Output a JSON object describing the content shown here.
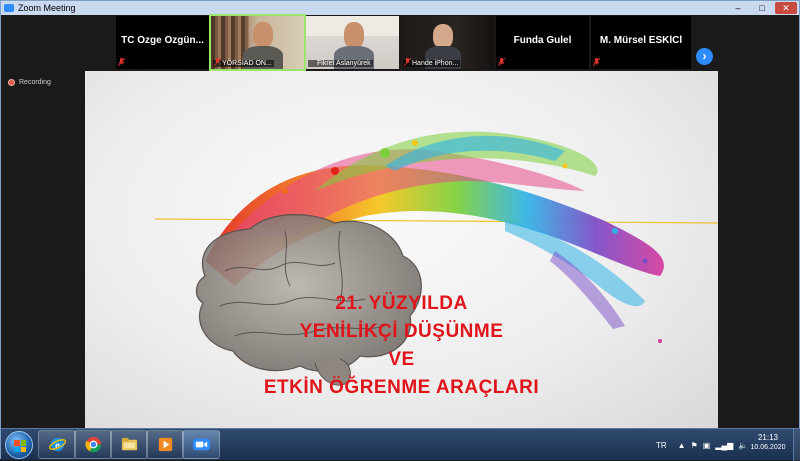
{
  "window": {
    "title": "Zoom Meeting"
  },
  "participants": [
    {
      "name": "TC Özge Özgün...",
      "video": false
    },
    {
      "name": "YÖRSİAD ON...",
      "video": true,
      "active": true
    },
    {
      "name": "Fikret Aslanyürek",
      "video": true
    },
    {
      "name": "Hande iPhon...",
      "video": true
    },
    {
      "name": "Funda Gulel",
      "video": false
    },
    {
      "name": "M. Mürsel ESKİCİ",
      "video": false
    }
  ],
  "next_button_icon": "chevron-right-icon",
  "recording": {
    "label": "Recording",
    "color": "#e35a44"
  },
  "slide": {
    "title_lines": [
      "21. YÜZYILDA",
      "YENİLİKÇİ DÜŞÜNME",
      "VE",
      "ETKİN ÖĞRENME ARAÇLARI"
    ],
    "title_color": "#e0141a"
  },
  "taskbar": {
    "pinned": [
      "windows-start-icon",
      "internet-explorer-icon",
      "chrome-icon",
      "file-explorer-icon",
      "media-player-icon",
      "zoom-icon"
    ],
    "language": "TR",
    "time": "21:13",
    "date": "10.06.2020"
  },
  "colors": {
    "zoom_blue": "#2d8cff",
    "active_speaker": "#9be66a",
    "taskbar": "#1b3050"
  }
}
